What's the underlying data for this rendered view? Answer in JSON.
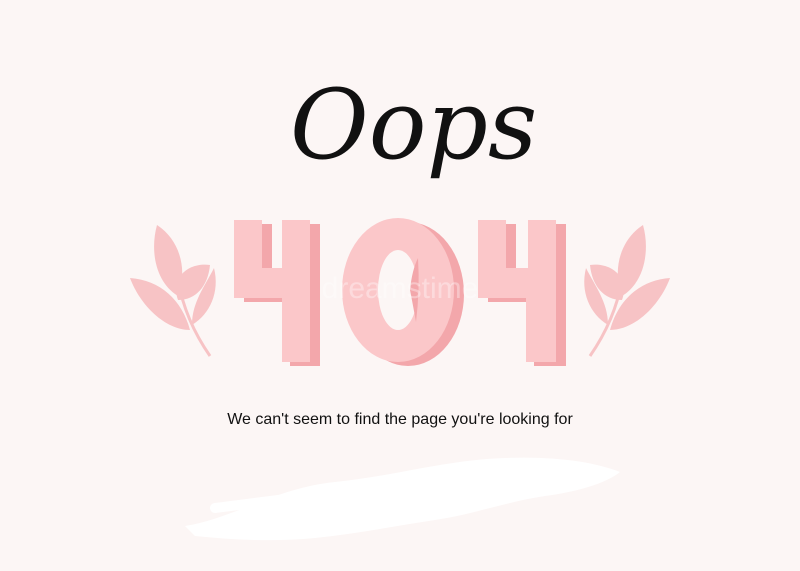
{
  "error": {
    "exclamation": "Oops!",
    "code": "404",
    "message": "We can't seem to find the page you're looking for"
  },
  "watermark": "dreamstime",
  "icons": {
    "left_decoration": "leaf-branch-icon",
    "right_decoration": "leaf-branch-icon"
  },
  "colors": {
    "background": "#fcf6f5",
    "accent_pink": "#f7b9bc",
    "accent_pink_dark": "#f0a0a6",
    "text": "#111111"
  }
}
